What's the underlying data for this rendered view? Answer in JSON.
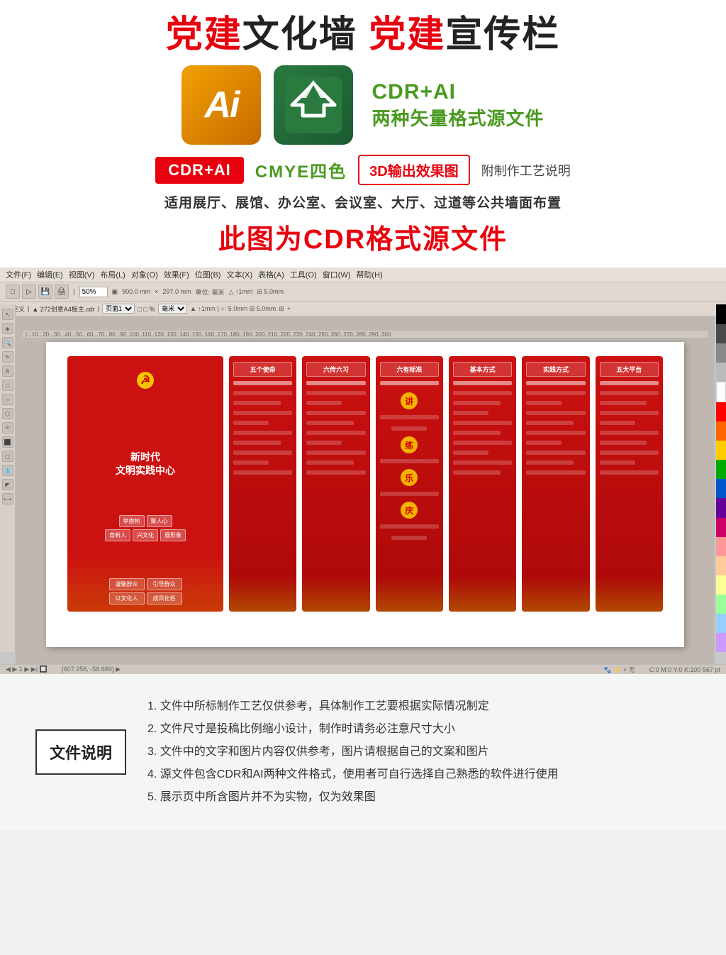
{
  "header": {
    "title_part1": "党建",
    "title_mid1": "文化墙 ",
    "title_part2": "党建",
    "title_mid2": "宣传栏"
  },
  "format_badge": {
    "icon_ai_text": "Ai",
    "format_line1": "CDR+AI",
    "format_line2": "两种矢量格式源文件"
  },
  "tags": {
    "tag1": "CDR+AI",
    "tag2": "CMYE四色",
    "tag3": "3D输出效果图",
    "tag4": "附制作工艺说明"
  },
  "subtitle": "适用展厅、展馆、办公室、会议室、大厅、过道等公共墙面布置",
  "big_red_text": "此图为CDR格式源文件",
  "software": {
    "menubar": [
      "文件(F)",
      "编辑(E)",
      "视图(V)",
      "布局(L)",
      "对象(O)",
      "效果(F)",
      "位图(B)",
      "文本(X)",
      "表格(A)",
      "工具(O)",
      "窗口(W)",
      "帮助(H)"
    ],
    "filename": "272创意A4板主.cdr",
    "zoom": "50%",
    "size_w": "900.0 mm",
    "size_h": "297.0 mm",
    "unit": "毫米",
    "step": "5.0 mm",
    "coords": "607.258, -58.669"
  },
  "design": {
    "main_panel": {
      "symbol": "☭",
      "title_line1": "新时代",
      "title_line2": "文明实践中心",
      "buttons": [
        "凝聚群众",
        "引导群众",
        "以文化人",
        "成风化俗"
      ],
      "tags": [
        "举旗帜",
        "聚人心",
        "育新人",
        "兴文化",
        "展形象"
      ]
    },
    "side_panels": [
      {
        "header": "五个使命"
      },
      {
        "header": "六传六习"
      },
      {
        "header": "六有标准"
      },
      {
        "header": "基本方式"
      },
      {
        "header": "实践方式"
      },
      {
        "header": "五大平台"
      }
    ]
  },
  "notes": {
    "label": "文件说明",
    "items": [
      "1. 文件中所标制作工艺仅供参考，具体制作工艺要根据实际情况制定",
      "2. 文件尺寸是投稿比例缩小设计，制作时请务必注意尺寸大小",
      "3. 文件中的文字和图片内容仅供参考，图片请根据自己的文案和图片",
      "4. 源文件包含CDR和AI两种文件格式，使用者可自行选择自己熟悉的软件进行使用",
      "5. 展示页中所含图片并不为实物，仅为效果图"
    ]
  },
  "palette_colors": [
    "#000000",
    "#4a4a4a",
    "#808080",
    "#c0c0c0",
    "#ffffff",
    "#ff0000",
    "#ff6600",
    "#ffcc00",
    "#00aa00",
    "#0055cc",
    "#660099",
    "#cc0066",
    "#ff9999",
    "#ffcc99",
    "#ffff99",
    "#99ff99",
    "#99ccff",
    "#cc99ff"
  ]
}
